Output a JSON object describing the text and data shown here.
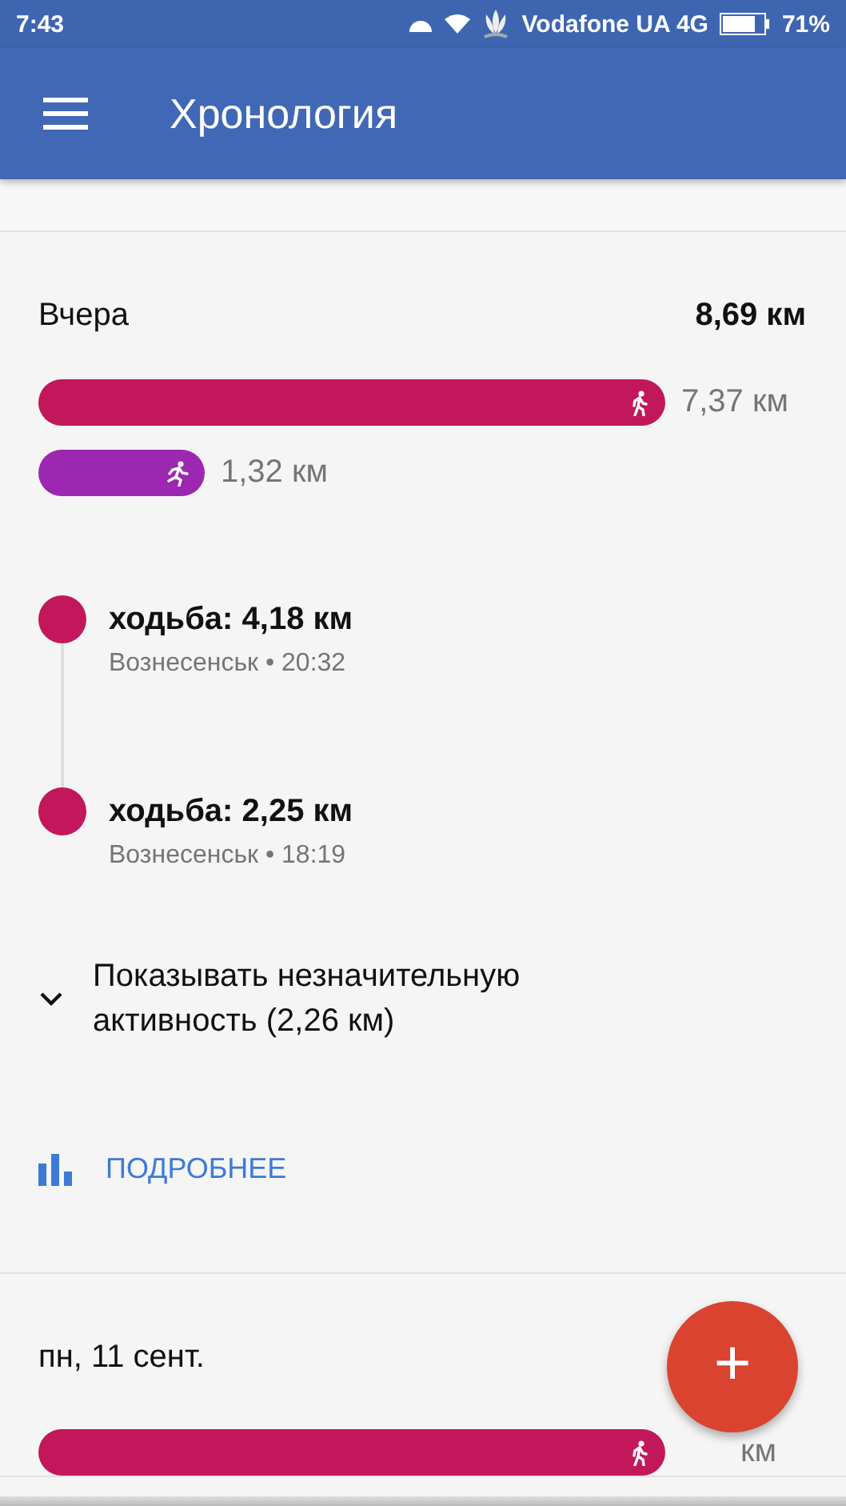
{
  "status_bar": {
    "time": "7:43",
    "carrier": "Vodafone UA 4G",
    "battery": "71%"
  },
  "app_bar": {
    "title": "Хронология"
  },
  "days": [
    {
      "label": "Вчера",
      "total": "8,69 км",
      "bars": [
        {
          "kind": "walking",
          "color": "#c2185b",
          "reading": "7,37 км"
        },
        {
          "kind": "running",
          "color": "#9c27b0",
          "reading": "1,32 км"
        }
      ],
      "activities": [
        {
          "title": "ходьба: 4,18 км",
          "place": "Вознесенськ • 20:32",
          "color": "#c2185b"
        },
        {
          "title": "ходьба: 2,25 км",
          "place": "Вознесенськ • 18:19",
          "color": "#c2185b"
        }
      ],
      "minor_toggle": {
        "label": "Показывать незначительную активность (2,26 км)",
        "expanded": false
      },
      "details_link": "ПОДРОБНЕЕ"
    },
    {
      "label": "пн, 11 сент.",
      "bars": [
        {
          "kind": "walking",
          "color": "#c2185b",
          "reading": "км"
        }
      ]
    }
  ],
  "fab": {
    "label": "+"
  }
}
